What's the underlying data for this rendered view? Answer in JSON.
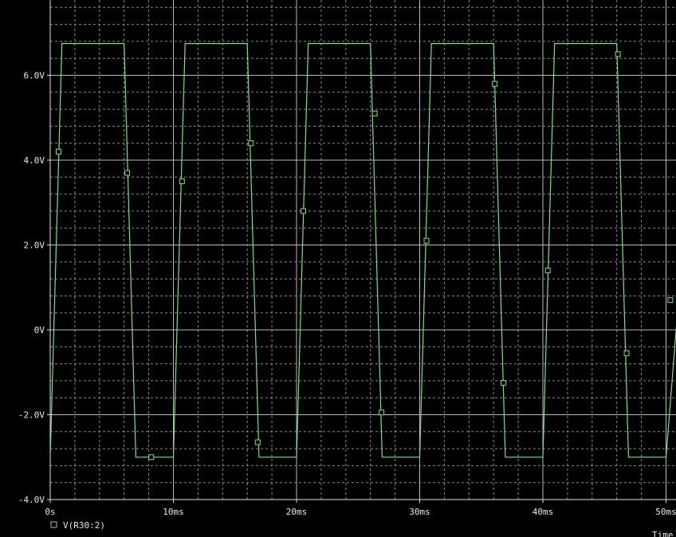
{
  "chart_data": {
    "type": "line",
    "title": "",
    "xlabel": "Time",
    "ylabel": "",
    "xlim": [
      0,
      51.5
    ],
    "ylim": [
      -4.0,
      7.6
    ],
    "grid": true,
    "y_ticks": [
      {
        "value": 6.0,
        "label": "6.0V"
      },
      {
        "value": 4.0,
        "label": "4.0V"
      },
      {
        "value": 2.0,
        "label": "2.0V"
      },
      {
        "value": 0.0,
        "label": "0V"
      },
      {
        "value": -2.0,
        "label": "-2.0V"
      },
      {
        "value": -4.0,
        "label": "-4.0V"
      }
    ],
    "x_ticks": [
      {
        "value": 0,
        "label": "0s"
      },
      {
        "value": 10,
        "label": "10ms"
      },
      {
        "value": 20,
        "label": "20ms"
      },
      {
        "value": 30,
        "label": "30ms"
      },
      {
        "value": 40,
        "label": "40ms"
      },
      {
        "value": 50,
        "label": "50ms"
      }
    ],
    "series": [
      {
        "name": "V(R30:2)",
        "color": "#7fe07f",
        "marker": "square",
        "x": [
          0.0,
          0.95,
          6.0,
          6.95,
          10.0,
          10.95,
          16.0,
          16.95,
          20.0,
          20.95,
          26.0,
          26.95,
          30.0,
          30.95,
          36.0,
          36.95,
          40.0,
          40.95,
          46.0,
          46.95,
          50.0,
          51.5
        ],
        "y": [
          -3.0,
          6.75,
          6.75,
          -3.0,
          -3.0,
          6.75,
          6.75,
          -3.0,
          -3.0,
          6.75,
          6.75,
          -3.0,
          -3.0,
          6.75,
          6.75,
          -3.0,
          -3.0,
          6.75,
          6.75,
          -3.0,
          -3.0,
          2.5
        ],
        "markers": [
          {
            "x": 0.68,
            "y": 4.2
          },
          {
            "x": 6.25,
            "y": 3.7
          },
          {
            "x": 8.2,
            "y": -3.0
          },
          {
            "x": 10.7,
            "y": 3.5
          },
          {
            "x": 16.3,
            "y": 4.4
          },
          {
            "x": 16.85,
            "y": -2.65
          },
          {
            "x": 20.55,
            "y": 2.8
          },
          {
            "x": 26.35,
            "y": 5.1
          },
          {
            "x": 26.9,
            "y": -1.95
          },
          {
            "x": 30.55,
            "y": 2.1
          },
          {
            "x": 36.1,
            "y": 5.8
          },
          {
            "x": 36.8,
            "y": -1.25
          },
          {
            "x": 40.4,
            "y": 1.4
          },
          {
            "x": 46.1,
            "y": 6.5
          },
          {
            "x": 46.8,
            "y": -0.55
          },
          {
            "x": 50.35,
            "y": 0.7
          }
        ]
      }
    ]
  }
}
